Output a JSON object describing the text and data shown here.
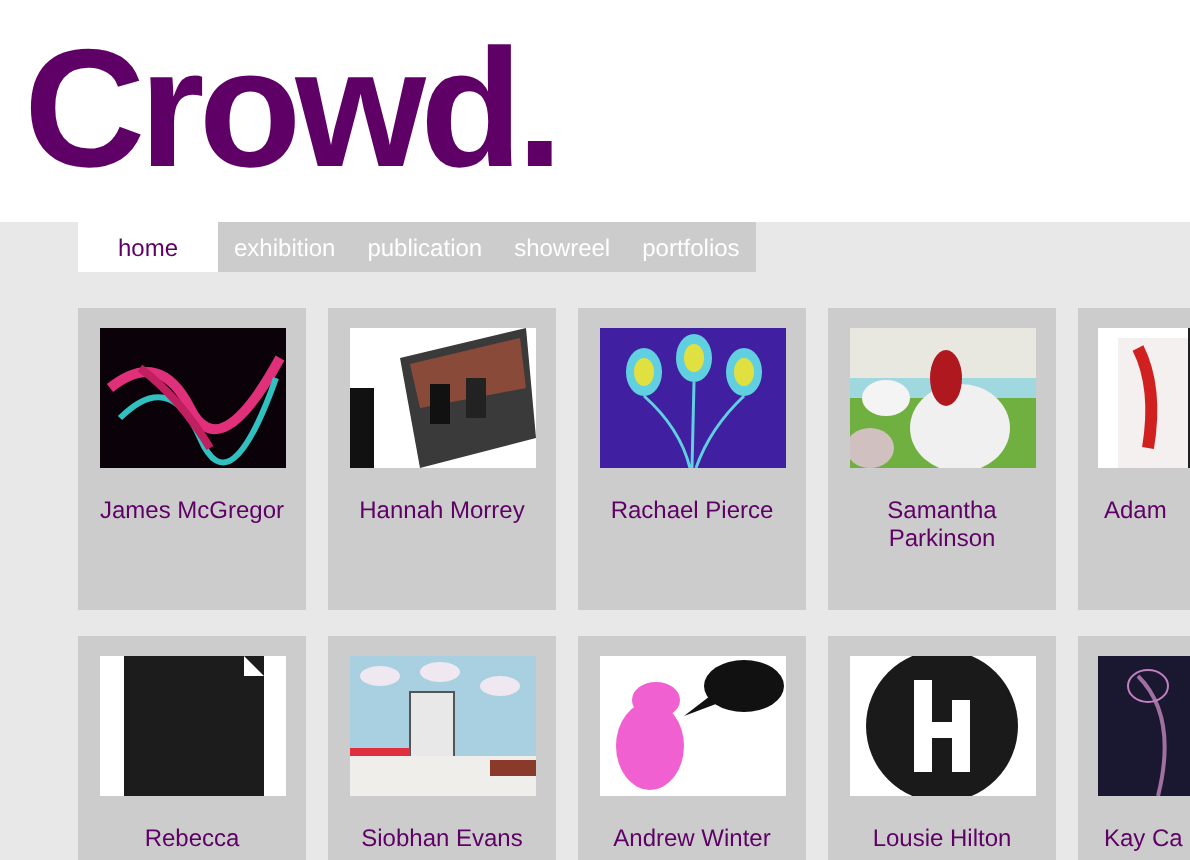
{
  "logo": "Crowd.",
  "nav": [
    {
      "label": "home",
      "selected": true
    },
    {
      "label": "exhibition",
      "selected": false
    },
    {
      "label": "publication",
      "selected": false
    },
    {
      "label": "showreel",
      "selected": false
    },
    {
      "label": "portfolios",
      "selected": false
    }
  ],
  "artists": [
    {
      "name": "James McGregor"
    },
    {
      "name": "Hannah Morrey"
    },
    {
      "name": "Rachael Pierce"
    },
    {
      "name": "Samantha Parkinson"
    },
    {
      "name": "Adam"
    },
    {
      "name": "Rebecca"
    },
    {
      "name": "Siobhan Evans"
    },
    {
      "name": "Andrew Winter"
    },
    {
      "name": "Lousie Hilton"
    },
    {
      "name": "Kay Ca"
    }
  ]
}
